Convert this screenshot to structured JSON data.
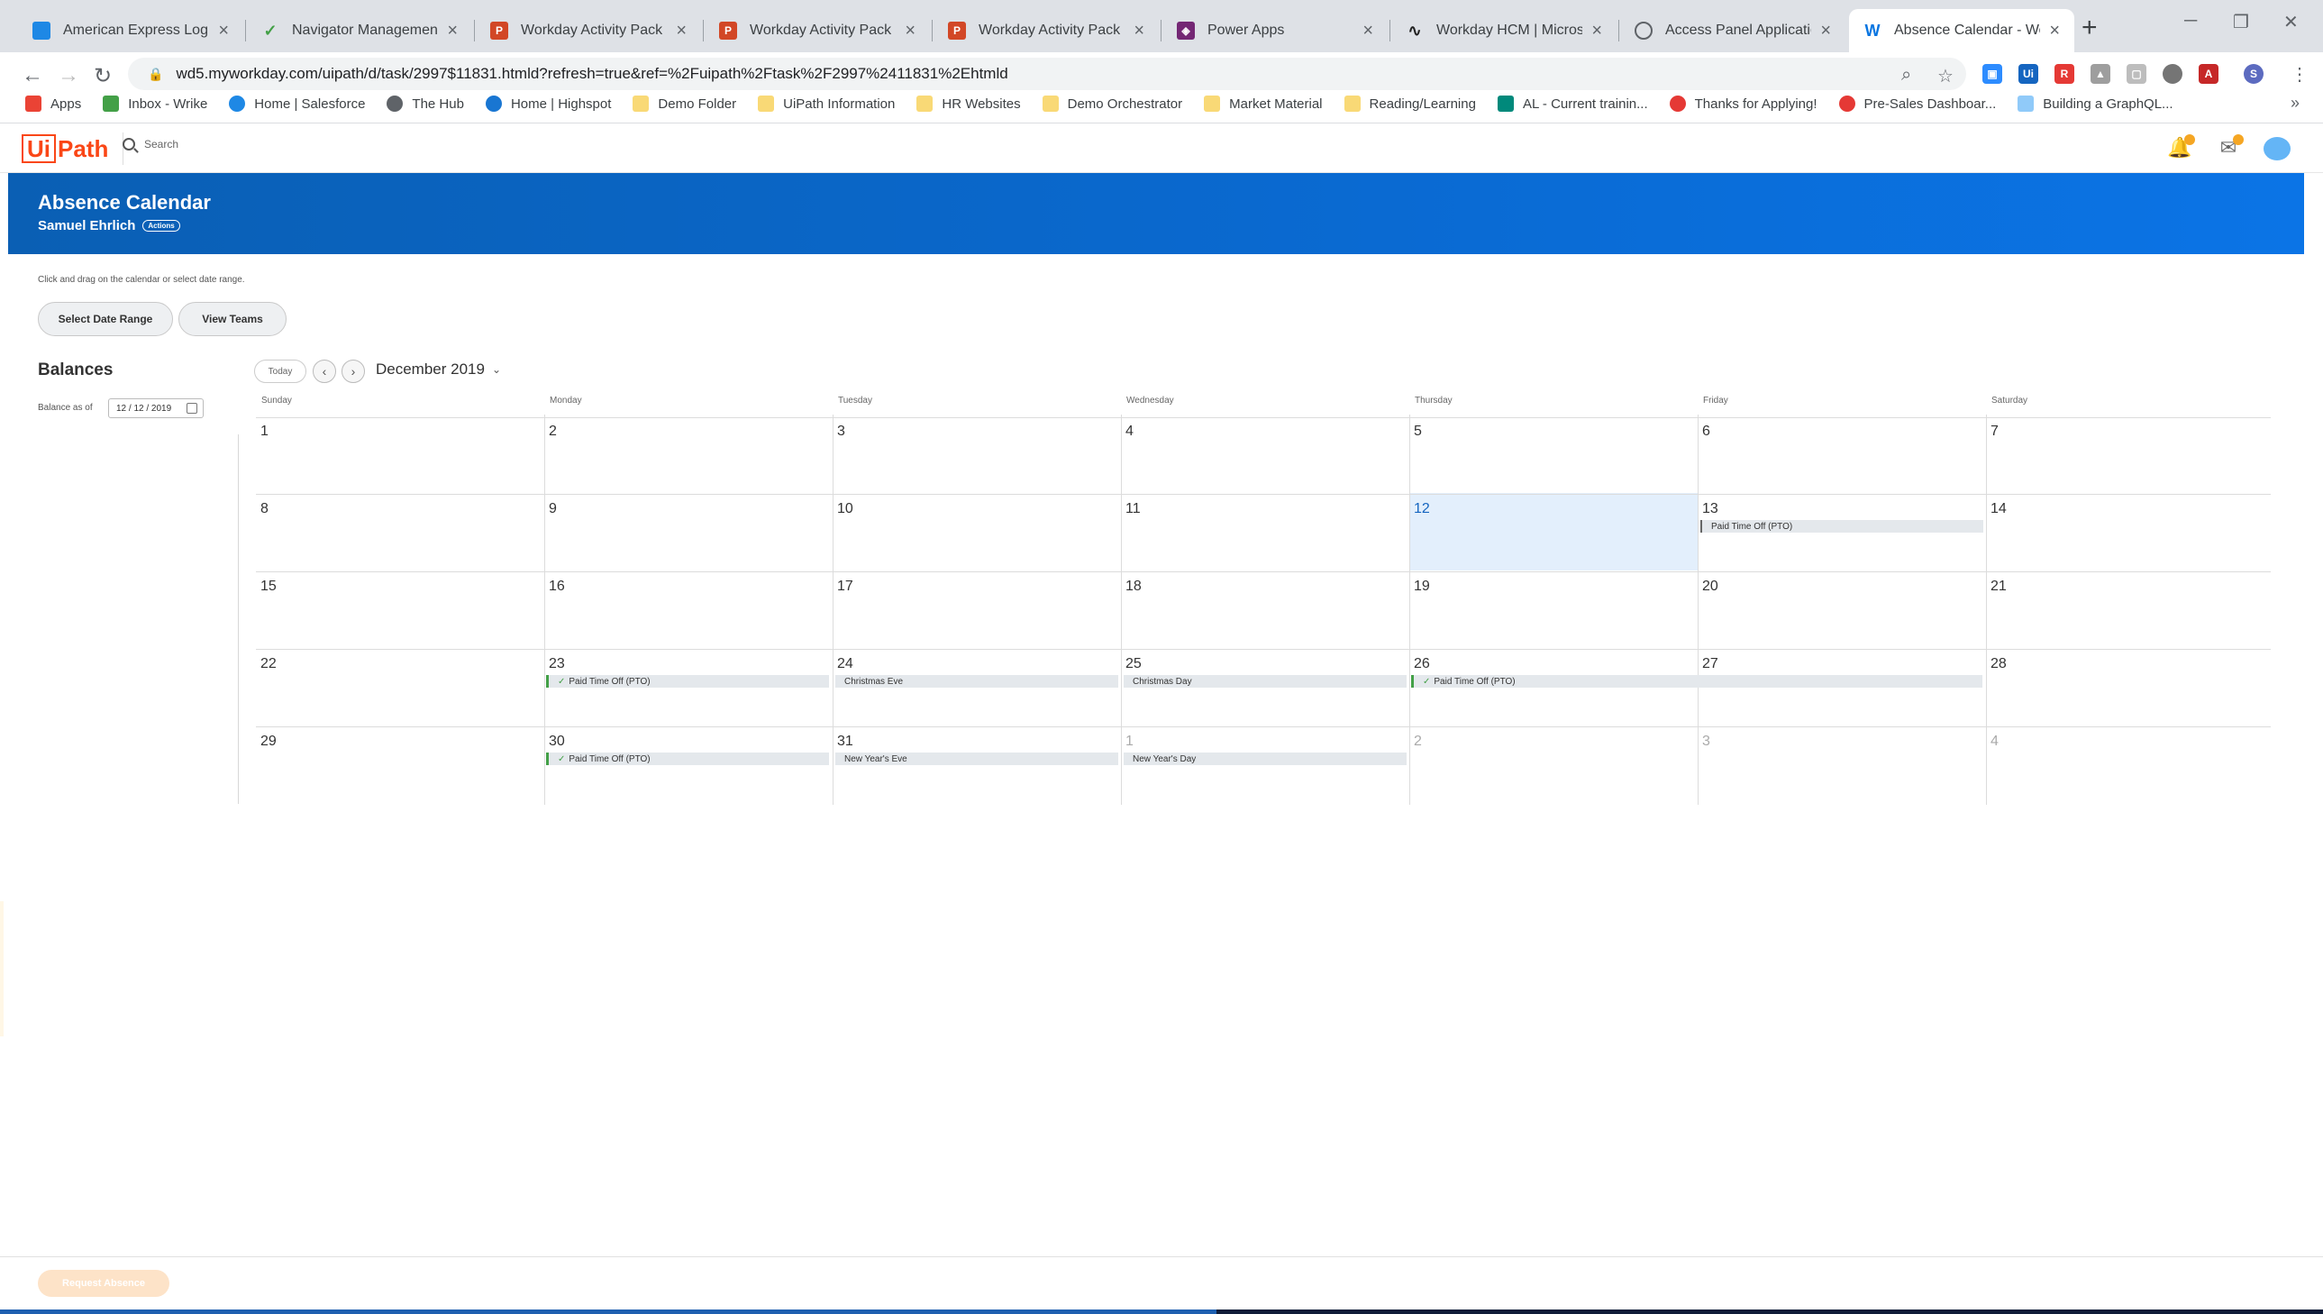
{
  "browser": {
    "tabs": [
      {
        "title": "American Express Login",
        "icon": "amex-icon",
        "color": "#1e88e5"
      },
      {
        "title": "Navigator Management P",
        "icon": "checkmark-icon",
        "color": "#43a047"
      },
      {
        "title": "Workday Activity Pack De",
        "icon": "powerpoint-icon",
        "color": "#d24726"
      },
      {
        "title": "Workday Activity Pack De",
        "icon": "powerpoint-icon",
        "color": "#d24726"
      },
      {
        "title": "Workday Activity Pack De",
        "icon": "powerpoint-icon",
        "color": "#d24726"
      },
      {
        "title": "Power Apps",
        "icon": "powerapps-icon",
        "color": "#742774"
      },
      {
        "title": "Workday HCM | Microsoft",
        "icon": "connector-icon",
        "color": "#222222"
      },
      {
        "title": "Access Panel Applications",
        "icon": "globe-icon",
        "color": "#5f6368"
      },
      {
        "title": "Absence Calendar - Work",
        "icon": "workday-icon",
        "color": "#0875e1",
        "active": true
      }
    ],
    "url": "wd5.myworkday.com/uipath/d/task/2997$11831.htmld?refresh=true&ref=%2Fuipath%2Ftask%2F2997%2411831%2Ehtmld",
    "bookmarks": [
      {
        "label": "Apps",
        "color": "#ea4335"
      },
      {
        "label": "Inbox - Wrike",
        "color": "#43a047"
      },
      {
        "label": "Home | Salesforce",
        "color": "#1e88e5"
      },
      {
        "label": "The Hub",
        "color": "#5f6368"
      },
      {
        "label": "Home | Highspot",
        "color": "#1976d2"
      },
      {
        "label": "Demo Folder",
        "color": "#f9d976"
      },
      {
        "label": "UiPath Information",
        "color": "#f9d976"
      },
      {
        "label": "HR Websites",
        "color": "#f9d976"
      },
      {
        "label": "Demo Orchestrator",
        "color": "#f9d976"
      },
      {
        "label": "Market Material",
        "color": "#f9d976"
      },
      {
        "label": "Reading/Learning",
        "color": "#f9d976"
      },
      {
        "label": "AL - Current trainin...",
        "color": "#00897b"
      },
      {
        "label": "Thanks for Applying!",
        "color": "#e53935"
      },
      {
        "label": "Pre-Sales Dashboar...",
        "color": "#e53935"
      },
      {
        "label": "Building a GraphQL...",
        "color": "#90caf9"
      }
    ]
  },
  "app": {
    "logo_text": "UiPath",
    "search_label": "Search"
  },
  "banner": {
    "title": "Absence Calendar",
    "worker": "Samuel Ehrlich",
    "actions": "Actions"
  },
  "page": {
    "hint": "Click and drag on the calendar or select date range.",
    "select_range_label": "Select Date Range",
    "view_teams_label": "View Teams",
    "balances_title": "Balances",
    "balance_as_of_label": "Balance as of",
    "balance_date": "12 / 12 / 2019",
    "request_absence_label": "Request Absence"
  },
  "calendar": {
    "today_label": "Today",
    "month": "December 2019",
    "weekdays": [
      "Sunday",
      "Monday",
      "Tuesday",
      "Wednesday",
      "Thursday",
      "Friday",
      "Saturday"
    ],
    "weeks": [
      [
        "1",
        "2",
        "3",
        "4",
        "5",
        "6",
        "7"
      ],
      [
        "8",
        "9",
        "10",
        "11",
        "12",
        "13",
        "14"
      ],
      [
        "15",
        "16",
        "17",
        "18",
        "19",
        "20",
        "21"
      ],
      [
        "22",
        "23",
        "24",
        "25",
        "26",
        "27",
        "28"
      ],
      [
        "29",
        "30",
        "31",
        "1",
        "2",
        "3",
        "4"
      ]
    ],
    "events": {
      "pto": "Paid Time Off (PTO)",
      "christmas_eve": "Christmas Eve",
      "christmas_day": "Christmas Day",
      "new_years_eve": "New Year's Eve",
      "new_years_day": "New Year's Day"
    }
  },
  "colors": {
    "accent": "#0a6ad2",
    "brand": "#fa4616",
    "today_fill": "#e3effc",
    "approved": "#43a047"
  }
}
